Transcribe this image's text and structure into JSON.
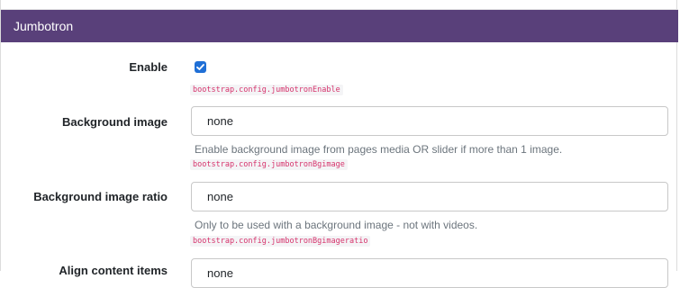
{
  "panel": {
    "title": "Jumbotron"
  },
  "fields": {
    "enable": {
      "label": "Enable",
      "checked": true,
      "config_key": "bootstrap.config.jumbotronEnable"
    },
    "background_image": {
      "label": "Background image",
      "value": "none",
      "help": "Enable background image from pages media OR slider if more than 1 image.",
      "config_key": "bootstrap.config.jumbotronBgimage"
    },
    "background_image_ratio": {
      "label": "Background image ratio",
      "value": "none",
      "help": "Only to be used with a background image - not with videos.",
      "config_key": "bootstrap.config.jumbotronBgimageratio"
    },
    "align_content_items": {
      "label": "Align content items",
      "value": "none"
    }
  },
  "colors": {
    "header_bg": "#59407a",
    "checkbox": "#1f6fd6",
    "code_text": "#d6336c"
  },
  "icons": {
    "checkbox": "check-icon"
  }
}
